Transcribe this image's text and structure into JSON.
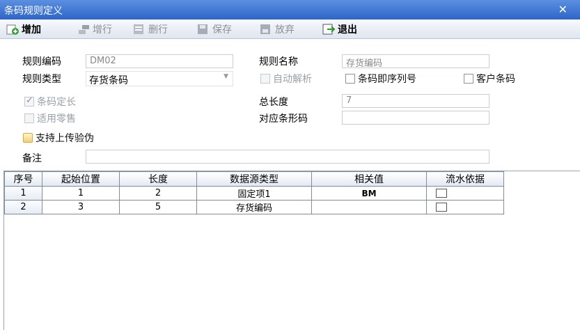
{
  "window": {
    "title": "条码规则定义"
  },
  "toolbar": {
    "add": "增加",
    "add_row": "增行",
    "delete_row": "删行",
    "save": "保存",
    "discard": "放弃",
    "exit": "退出"
  },
  "form": {
    "rule_code_label": "规则编码",
    "rule_code_value": "DM02",
    "rule_name_label": "规则名称",
    "rule_name_value": "存货编码",
    "rule_type_label": "规则类型",
    "rule_type_value": "存货条码",
    "auto_parse_label": "自动解析",
    "barcode_is_serial_label": "条码即序列号",
    "customer_barcode_label": "客户条码",
    "fixed_length_label": "条码定长",
    "total_length_label": "总长度",
    "total_length_value": "7",
    "retail_label": "适用零售",
    "barcode_shape_label": "对应条形码",
    "barcode_shape_value": "",
    "upload_verify_label": "支持上传验伪",
    "remark_label": "备注",
    "remark_value": ""
  },
  "grid": {
    "headers": [
      "序号",
      "起始位置",
      "长度",
      "数据源类型",
      "相关值",
      "流水依据"
    ],
    "rows": [
      {
        "seq": "1",
        "start": "1",
        "length": "2",
        "source_type": "固定项1",
        "value": "BM"
      },
      {
        "seq": "2",
        "start": "3",
        "length": "5",
        "source_type": "存货编码",
        "value": ""
      }
    ]
  }
}
